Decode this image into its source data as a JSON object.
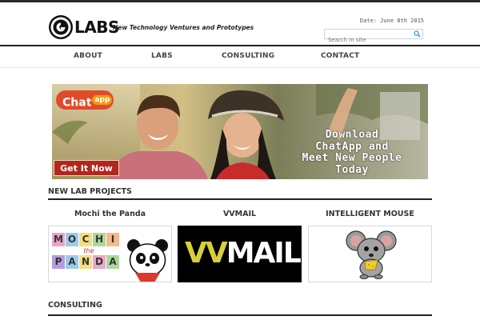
{
  "header": {
    "logo_text": "LABS",
    "tagline": "New Technology Ventures and Prototypes",
    "date": "Date: June 8th 2015",
    "search_placeholder": "Search in site",
    "search_icon": "search-icon"
  },
  "nav": {
    "items": [
      {
        "label": "ABOUT"
      },
      {
        "label": "LABS"
      },
      {
        "label": "CONSULTING"
      },
      {
        "label": "CONTACT"
      }
    ]
  },
  "banner": {
    "badge_text": "Chat",
    "badge_sup": "app",
    "cta_label": "Get It Now",
    "headline_lines": [
      "Download",
      "ChatApp and",
      "Meet New People",
      "Today"
    ]
  },
  "lab_projects": {
    "section_title": "NEW LAB PROJECTS",
    "projects": [
      {
        "title": "Mochi the Panda",
        "logo_letters_top": [
          "M",
          "O",
          "C",
          "H",
          "I"
        ],
        "logo_mid": "the",
        "logo_letters_bottom": [
          "P",
          "A",
          "N",
          "D",
          "A"
        ]
      },
      {
        "title": "VVMAIL",
        "logo_vv": "VV",
        "logo_mail": "MAIL"
      },
      {
        "title": "INTELLIGENT MOUSE"
      }
    ]
  },
  "consulting": {
    "section_title": "CONSULTING"
  },
  "colors": {
    "accent": "#29a3d6",
    "cta": "#c0392b",
    "dark": "#222222"
  }
}
